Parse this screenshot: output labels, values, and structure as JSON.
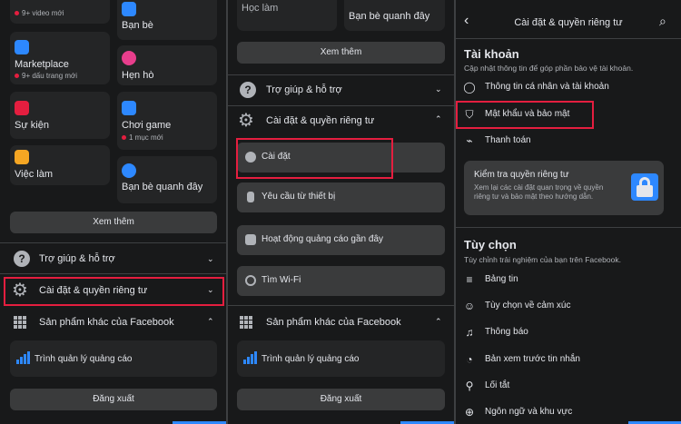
{
  "colors": {
    "accent": "#2d88ff",
    "highlight": "#e41e3f",
    "bg": "#18191a",
    "card": "#242526"
  },
  "panel1": {
    "tiles": {
      "video_sub": "9+ video mới",
      "friends": "Bạn bè",
      "marketplace": "Marketplace",
      "marketplace_sub": "9+ dấu trang mới",
      "dating": "Hẹn hò",
      "events": "Sự kiện",
      "gaming": "Chơi game",
      "gaming_sub": "1 mục mới",
      "jobs": "Việc làm",
      "nearby_friends": "Bạn bè quanh đây"
    },
    "see_more": "Xem thêm",
    "help": "Trợ giúp & hỗ trợ",
    "settings_privacy": "Cài đặt & quyền riêng tư",
    "other_products": "Sản phẩm khác của Facebook",
    "ads_manager": "Trình quản lý quảng cáo",
    "logout": "Đăng xuất"
  },
  "panel2": {
    "tile_left_partial": "Học làm",
    "nearby_friends": "Bạn bè quanh đây",
    "see_more": "Xem thêm",
    "help": "Trợ giúp & hỗ trợ",
    "settings_privacy": "Cài đặt & quyền riêng tư",
    "settings": "Cài đặt",
    "device_requests": "Yêu cầu từ thiết bị",
    "ad_activity": "Hoạt động quảng cáo gần đây",
    "find_wifi": "Tìm Wi-Fi",
    "other_products": "Sản phẩm khác của Facebook",
    "ads_manager": "Trình quản lý quảng cáo",
    "logout": "Đăng xuất"
  },
  "panel3": {
    "title": "Cài đặt & quyền riêng tư",
    "account_header": "Tài khoản",
    "account_desc": "Cập nhật thông tin để góp phần bảo vệ tài khoản.",
    "personal_info": "Thông tin cá nhân và tài khoản",
    "password_security": "Mật khẩu và bảo mật",
    "payments": "Thanh toán",
    "privacy_check_title": "Kiểm tra quyền riêng tư",
    "privacy_check_desc": "Xem lại các cài đặt quan trọng về quyền riêng tư và bảo mật theo hướng dẫn.",
    "preferences_header": "Tùy chọn",
    "preferences_desc": "Tùy chỉnh trải nghiệm của bạn trên Facebook.",
    "news_feed": "Bảng tin",
    "reactions": "Tùy chọn về cảm xúc",
    "notifications": "Thông báo",
    "message_previews": "Bản xem trước tin nhắn",
    "shortcuts": "Lối tắt",
    "language_region": "Ngôn ngữ và khu vực"
  }
}
